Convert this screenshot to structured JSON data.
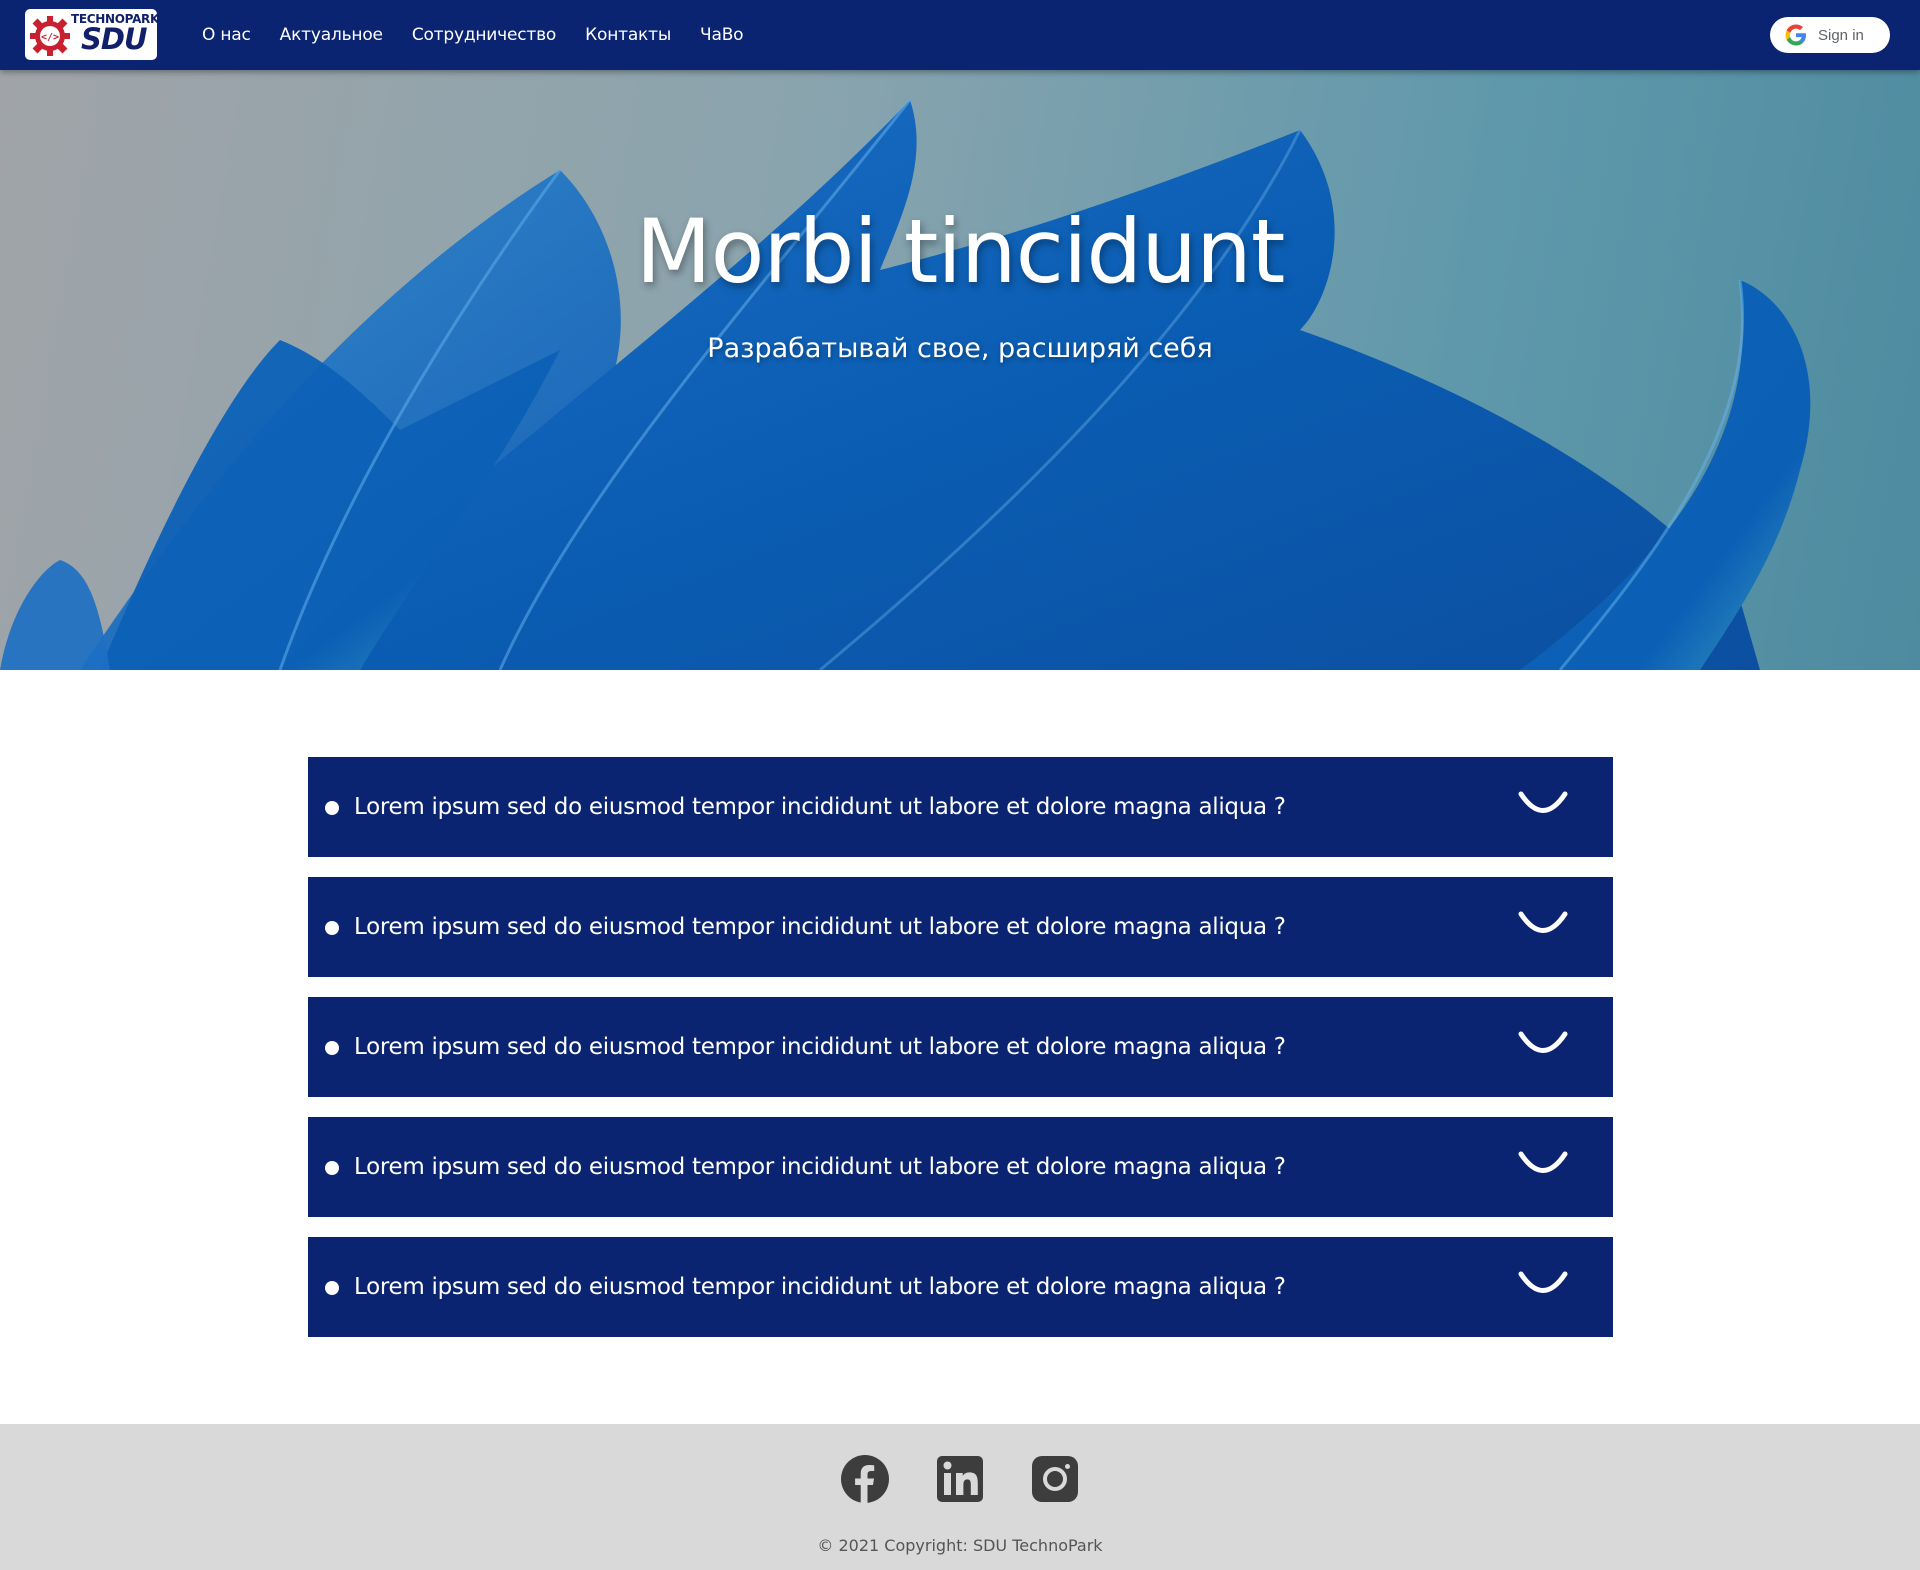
{
  "navbar": {
    "logo": {
      "top_text": "TECHNOPARK",
      "main_text": "SDU"
    },
    "links": [
      "О нас",
      "Актуальное",
      "Сотрудничество",
      "Контакты",
      "ЧаВо"
    ],
    "signin_label": "Sign in",
    "color": "#0b2471"
  },
  "hero": {
    "title": "Morbi tincidunt",
    "subtitle": "Разрабатывай свое, расширяй себя"
  },
  "faq": {
    "items": [
      "Lorem ipsum sed do eiusmod tempor incididunt ut labore et dolore magna aliqua ?",
      "Lorem ipsum sed do eiusmod tempor incididunt ut labore et dolore magna aliqua ?",
      "Lorem ipsum sed do eiusmod tempor incididunt ut labore et dolore magna aliqua ?",
      "Lorem ipsum sed do eiusmod tempor incididunt ut labore et dolore magna aliqua ?",
      "Lorem ipsum sed do eiusmod tempor incididunt ut labore et dolore magna aliqua ?"
    ],
    "item_color": "#0b2471"
  },
  "footer": {
    "social": [
      "facebook-icon",
      "linkedin-icon",
      "instagram-icon"
    ],
    "copyright": "© 2021 Copyright: SDU TechnoPark",
    "background": "#d9d9d9"
  }
}
